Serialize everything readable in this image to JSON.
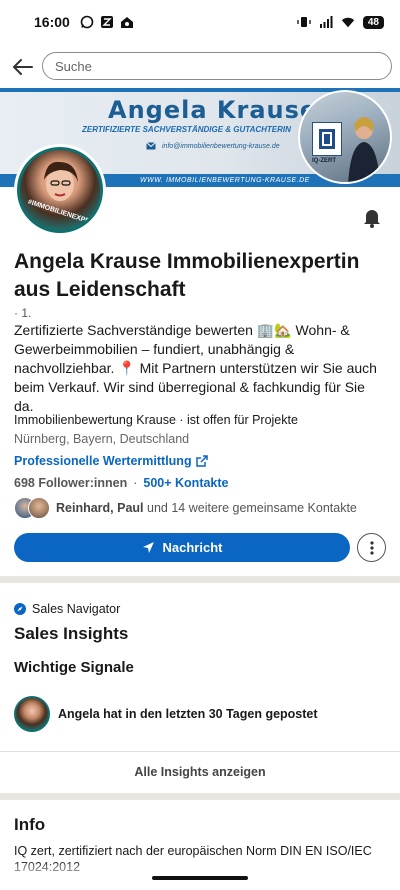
{
  "status": {
    "time": "16:00",
    "battery": "48"
  },
  "search": {
    "placeholder": "Suche"
  },
  "banner": {
    "name": "Angela Krause",
    "subtitle": "ZERTIFIZIERTE SACHVERSTÄNDIGE & GUTACHTERIN",
    "email": "info@immobilienbewertung-krause.de",
    "url": "WWW. IMMOBILIENBEWERTUNG-KRAUSE.DE",
    "badge": "IQ-ZERT"
  },
  "avatar": {
    "ring_text": "#IMMOBILIENEXPERTIN"
  },
  "profile": {
    "name": "Angela Krause  Immobilienexpertin aus Leidenschaft",
    "degree": "· 1.",
    "headline": "Zertifizierte Sachverständige bewerten 🏢🏡 Wohn- & Gewerbeimmobilien – fundiert, unabhängig & nachvollziehbar.  📍 Mit Partnern unterstützen wir Sie auch beim Verkauf.  Wir sind überregional & fachkundig für Sie da.",
    "company": "Immobilienbewertung Krause · ist offen für Projekte",
    "location": "Nürnberg, Bayern, Deutschland",
    "link": "Professionelle Wertermittlung",
    "followers": "698 Follower:innen",
    "separator": "·",
    "contacts": "500+ Kontakte",
    "mutual_names": "Reinhard, Paul",
    "mutual_rest": "und 14 weitere gemeinsame Kontakte"
  },
  "actions": {
    "message": "Nachricht"
  },
  "sales": {
    "navigator": "Sales Navigator",
    "insights_title": "Sales Insights",
    "signals_title": "Wichtige Signale",
    "signal_text": "Angela hat in den letzten 30 Tagen gepostet",
    "all_insights": "Alle Insights anzeigen"
  },
  "info": {
    "title": "Info",
    "text": "IQ zert, zertifiziert nach der europäischen Norm DIN EN ISO/IEC 17024:2012"
  },
  "colors": {
    "accent": "#0a66c2",
    "banner_blue": "#1e73b8"
  }
}
